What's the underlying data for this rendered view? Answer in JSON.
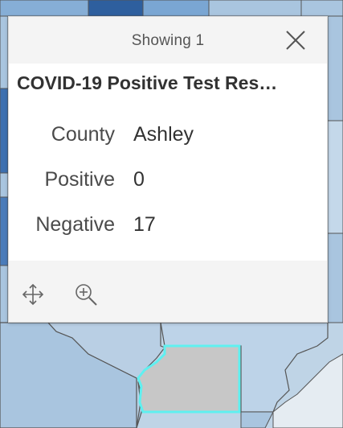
{
  "popup": {
    "status": "Showing 1",
    "title": "COVID-19 Positive Test Res…",
    "fields": [
      {
        "name": "County",
        "value": "Ashley"
      },
      {
        "name": "Positive",
        "value": "0"
      },
      {
        "name": "Negative",
        "value": "17"
      }
    ]
  },
  "actions": [
    {
      "icon": "pan-icon"
    },
    {
      "icon": "zoom-in-icon"
    }
  ],
  "colors": {
    "map_water": "#bfd4e6",
    "county_light": "#a9c5df",
    "county_mid": "#6f9fcc",
    "county_dark": "#2e5f9e",
    "county_selected": "#c7c7c7",
    "selection_outline": "#5ff0f0",
    "popup_bg": "#f4f4f4",
    "popup_body": "#ffffff"
  }
}
